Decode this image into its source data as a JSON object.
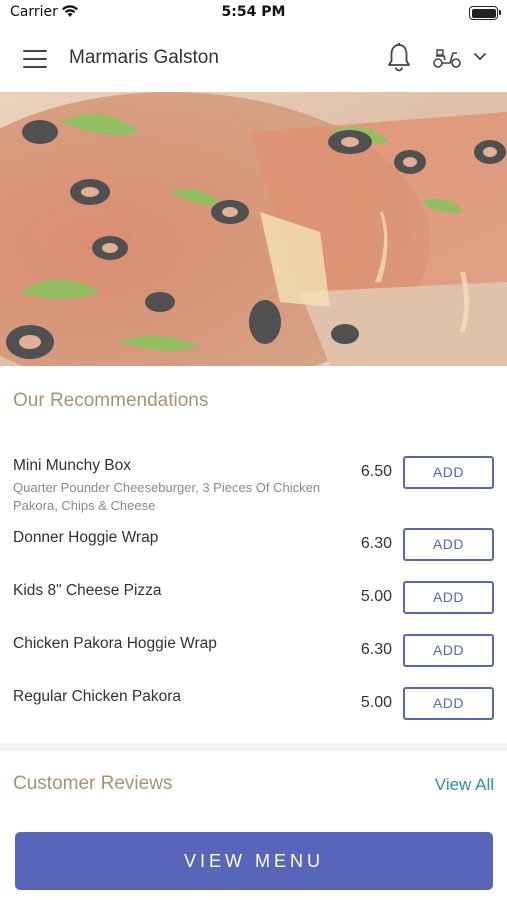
{
  "status_bar": {
    "carrier": "Carrier",
    "time": "5:54 PM"
  },
  "header": {
    "restaurant_name": "Marmaris Galston",
    "icons": [
      "menu-icon",
      "bell-icon",
      "scooter-icon",
      "chevron-down-icon"
    ]
  },
  "recommendations": {
    "title": "Our Recommendations",
    "add_label": "ADD",
    "items": [
      {
        "name": "Mini Munchy Box",
        "description": "Quarter Pounder Cheeseburger, 3 Pieces Of Chicken Pakora, Chips & Cheese",
        "price": "6.50"
      },
      {
        "name": "Donner Hoggie Wrap",
        "description": "",
        "price": "6.30"
      },
      {
        "name": "Kids 8\" Cheese Pizza",
        "description": "",
        "price": "5.00"
      },
      {
        "name": "Chicken Pakora Hoggie Wrap",
        "description": "",
        "price": "6.30"
      },
      {
        "name": "Regular Chicken Pakora",
        "description": "",
        "price": "5.00"
      }
    ]
  },
  "reviews": {
    "title": "Customer Reviews",
    "view_all": "View All"
  },
  "footer": {
    "view_menu": "VIEW MENU"
  },
  "colors": {
    "accent": "#5965b9",
    "section_title": "#a8956d",
    "link": "#2b8fb5"
  }
}
